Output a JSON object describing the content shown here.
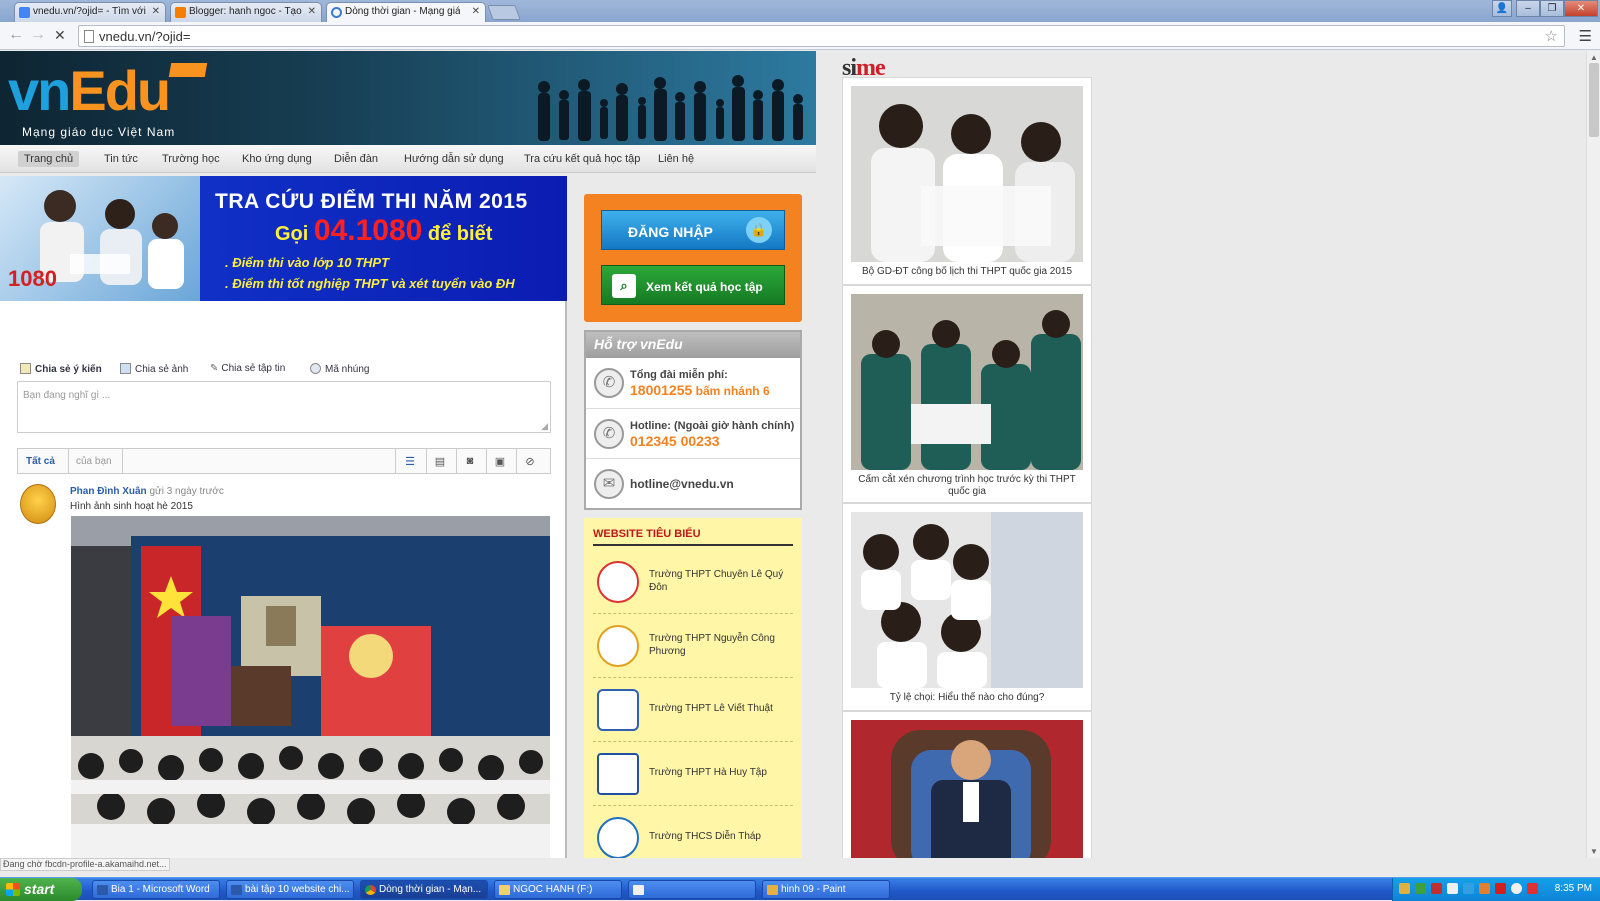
{
  "browser": {
    "tabs": [
      {
        "title": "vnedu.vn/?ojid= - Tìm với G..."
      },
      {
        "title": "Blogger: hanh ngoc - Tạo bà..."
      },
      {
        "title": "Dòng thời gian - Mạng giáo d..."
      }
    ],
    "url": "vnedu.vn/?ojid=",
    "status_text": "Đang chờ fbcdn-profile-a.akamaihd.net..."
  },
  "site": {
    "logo_vn": "vn",
    "logo_edu": "Edu",
    "tagline": "Mạng giáo dục Việt Nam",
    "nav": [
      "Trang chủ",
      "Tin tức",
      "Trường học",
      "Kho ứng dụng",
      "Diễn đàn",
      "Hướng dẫn sử dụng",
      "Tra cứu kết quả học tập",
      "Liên hệ"
    ]
  },
  "banner": {
    "title": "TRA CỨU ĐIỂM THI NĂM 2015",
    "call_prefix": "Gọi ",
    "call_number": "04.1080",
    "call_suffix": " để biết",
    "line1": ". Điểm thi vào lớp 10 THPT",
    "line2": ". Điểm thi tốt nghiệp THPT và xét tuyển vào ĐH",
    "hotline_badge": "1080"
  },
  "share": {
    "tabs": [
      "Chia sẻ ý kiến",
      "Chia sẻ ảnh",
      "Chia sẻ tập tin",
      "Mã nhúng"
    ],
    "placeholder": "Bạn đang nghĩ gì ...",
    "filter_all": "Tất cả",
    "filter_yours": "của bạn"
  },
  "post": {
    "author": "Phan Đình Xuân",
    "time": " gửi 3 ngày trước",
    "text": "Hình ảnh sinh hoạt hè 2015"
  },
  "login": {
    "login_label": "ĐĂNG NHẬP",
    "result_label": "Xem kết quả học tập"
  },
  "support": {
    "title": "Hỗ trợ vnEdu",
    "toll_free_label": "Tổng đài miễn phí:",
    "toll_free_number": "18001255",
    "toll_free_suffix": " bấm nhánh 6",
    "hotline_label": "Hotline: (Ngoài giờ hành chính)",
    "hotline_number": "012345 00233",
    "email": "hotline@vnedu.vn"
  },
  "websites": {
    "title": "WEBSITE TIÊU BIỂU",
    "items": [
      "Trường THPT Chuyên Lê Quý Đôn",
      "Trường THPT Nguyễn Công Phương",
      "Trường THPT Lê Viết Thuật",
      "Trường THPT Hà Huy Tập",
      "Trường THCS Diễn Tháp"
    ]
  },
  "news": {
    "brand_si": "si",
    "brand_me": "me",
    "items": [
      "Bộ GD-ĐT công bố lịch thi THPT quốc gia 2015",
      "Cấm cắt xén chương trình học trước kỳ thi THPT quốc gia",
      "Tỷ lệ chọi: Hiểu thế nào cho đúng?"
    ]
  },
  "taskbar": {
    "start": "start",
    "items": [
      "Bia 1 - Microsoft Word",
      "bài tập 10 website chi...",
      "Dòng thời gian - Mạn...",
      "NGOC HANH (F:)",
      "",
      "hinh 09 - Paint"
    ],
    "clock": "8:35 PM"
  }
}
